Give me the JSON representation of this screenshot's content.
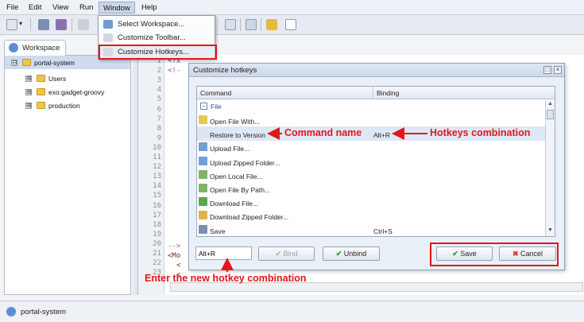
{
  "menubar": {
    "items": [
      "File",
      "Edit",
      "View",
      "Run",
      "Window",
      "Help"
    ]
  },
  "window_menu": {
    "items": [
      {
        "label": "Select Workspace...",
        "icon": "gear-icon"
      },
      {
        "label": "Customize Toolbar...",
        "icon": "toolbar-icon"
      },
      {
        "label": "Customize Hotkeys...",
        "icon": "keyboard-icon"
      }
    ]
  },
  "workspace": {
    "tab_label": "Workspace",
    "tree": [
      {
        "label": "portal-system",
        "expander": "⊟"
      },
      {
        "label": "Users",
        "expander": "⊞"
      },
      {
        "label": "exo:gadget-groovy",
        "expander": "⊞"
      },
      {
        "label": "production",
        "expander": "⊞"
      }
    ]
  },
  "editor": {
    "line_numbers": [
      "1",
      "2",
      "3",
      "4",
      "5",
      "6",
      "7",
      "8",
      "9",
      "10",
      "11",
      "12",
      "13",
      "14",
      "15",
      "16",
      "17",
      "18",
      "19",
      "20",
      "21",
      "22",
      "23"
    ],
    "code": {
      "line1": "<?x",
      "line2": "<!-",
      "line19": "-->",
      "line20": "<Mo",
      "line21": "<",
      "line22": "<"
    }
  },
  "statusbar": {
    "path": "portal-system"
  },
  "dialog": {
    "title": "Customize hotkeys",
    "columns": {
      "command": "Command",
      "binding": "Binding"
    },
    "group": "File",
    "rows": [
      {
        "command": "Open File With...",
        "binding": ""
      },
      {
        "command": "Restore to Version",
        "binding": "Alt+R"
      },
      {
        "command": "Upload File...",
        "binding": ""
      },
      {
        "command": "Upload Zipped Folder...",
        "binding": ""
      },
      {
        "command": "Open Local File...",
        "binding": ""
      },
      {
        "command": "Open File By Path...",
        "binding": ""
      },
      {
        "command": "Download File...",
        "binding": ""
      },
      {
        "command": "Download Zipped Folder...",
        "binding": ""
      },
      {
        "command": "Save",
        "binding": "Ctrl+S"
      }
    ],
    "hotkey_input": "Alt+R",
    "bind_label": "Bind",
    "unbind_label": "Unbind",
    "save_label": "Save",
    "cancel_label": "Cancel"
  },
  "annotations": {
    "command_name": "Command name",
    "hotkeys_combination": "Hotkeys combination",
    "enter_hotkey": "Enter the new hotkey combination"
  },
  "colors": {
    "annotation": "#e2171a",
    "selected_row": "#dde8f7",
    "menu_active": "#ccd8ea"
  }
}
